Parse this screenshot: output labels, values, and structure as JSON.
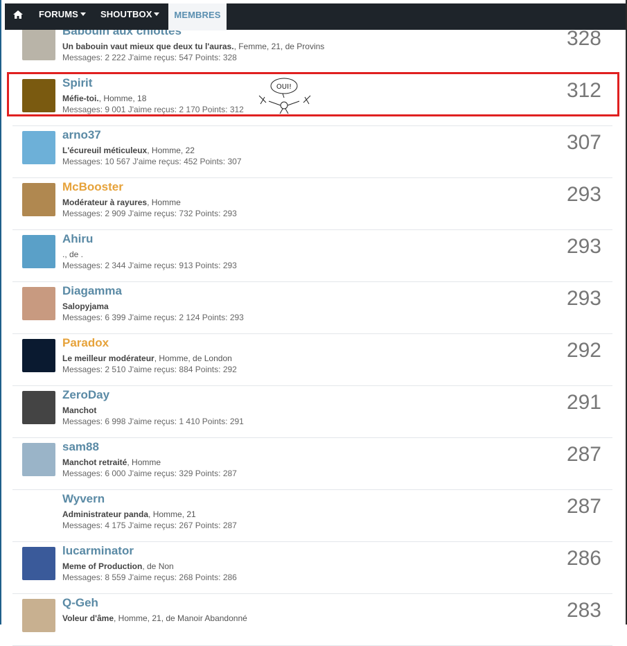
{
  "nav": {
    "home_icon": "home-icon",
    "forums": "FORUMS",
    "shoutbox": "SHOUTBOX",
    "membres": "MEMBRES"
  },
  "doodle_text": "OUI!",
  "members": [
    {
      "name": "Babouin aux chiottes",
      "title": "Un babouin vaut mieux que deux tu l'auras.",
      "details": ", Femme, 21, de Provins",
      "messages": "2 222",
      "likes": "547",
      "points": "328",
      "score": "328",
      "role": "user",
      "avatar_color": "#b9b4a8"
    },
    {
      "name": "Spirit",
      "title": "Méfie-toi.",
      "details": ", Homme, 18",
      "messages": "9 001",
      "likes": "2 170",
      "points": "312",
      "score": "312",
      "role": "user",
      "avatar_color": "#7a5a10"
    },
    {
      "name": "arno37",
      "title": "L'écureuil méticuleux",
      "details": ", Homme, 22",
      "messages": "10 567",
      "likes": "452",
      "points": "307",
      "score": "307",
      "role": "user",
      "avatar_color": "#6db0d8"
    },
    {
      "name": "McBooster",
      "title": "Modérateur à rayures",
      "details": ", Homme",
      "messages": "2 909",
      "likes": "732",
      "points": "293",
      "score": "293",
      "role": "moderator",
      "avatar_color": "#b08850"
    },
    {
      "name": "Ahiru",
      "title": "",
      "details": "., de .",
      "messages": "2 344",
      "likes": "913",
      "points": "293",
      "score": "293",
      "role": "user",
      "avatar_color": "#5aa0c8"
    },
    {
      "name": "Diagamma",
      "title": "Salopyjama",
      "details": "",
      "messages": "6 399",
      "likes": "2 124",
      "points": "293",
      "score": "293",
      "role": "user",
      "avatar_color": "#c89a80"
    },
    {
      "name": "Paradox",
      "title": "Le meilleur modérateur",
      "details": ", Homme, de London",
      "messages": "2 510",
      "likes": "884",
      "points": "292",
      "score": "292",
      "role": "moderator",
      "avatar_color": "#0a1a30"
    },
    {
      "name": "ZeroDay",
      "title": "Manchot",
      "details": "",
      "messages": "6 998",
      "likes": "1 410",
      "points": "291",
      "score": "291",
      "role": "user",
      "avatar_color": "#444444"
    },
    {
      "name": "sam88",
      "title": "Manchot retraité",
      "details": ", Homme",
      "messages": "6 000",
      "likes": "329",
      "points": "287",
      "score": "287",
      "role": "user",
      "avatar_color": "#9ab4c8"
    },
    {
      "name": "Wyvern",
      "title": "Administrateur panda",
      "details": ", Homme, 21",
      "messages": "4 175",
      "likes": "267",
      "points": "287",
      "score": "287",
      "role": "user",
      "avatar_color": "#ffffff"
    },
    {
      "name": "lucarminator",
      "title": "Meme of Production",
      "details": ", de Non",
      "messages": "8 559",
      "likes": "268",
      "points": "286",
      "score": "286",
      "role": "user",
      "avatar_color": "#3a5a9a"
    },
    {
      "name": "Q-Geh",
      "title": "Voleur d'âme",
      "details": ", Homme, 21, de Manoir Abandonné",
      "messages": "",
      "likes": "",
      "points": "",
      "score": "283",
      "role": "user",
      "avatar_color": "#c8b090"
    }
  ],
  "labels": {
    "messages": "Messages:",
    "likes": "J'aime reçus:",
    "points": "Points:"
  }
}
